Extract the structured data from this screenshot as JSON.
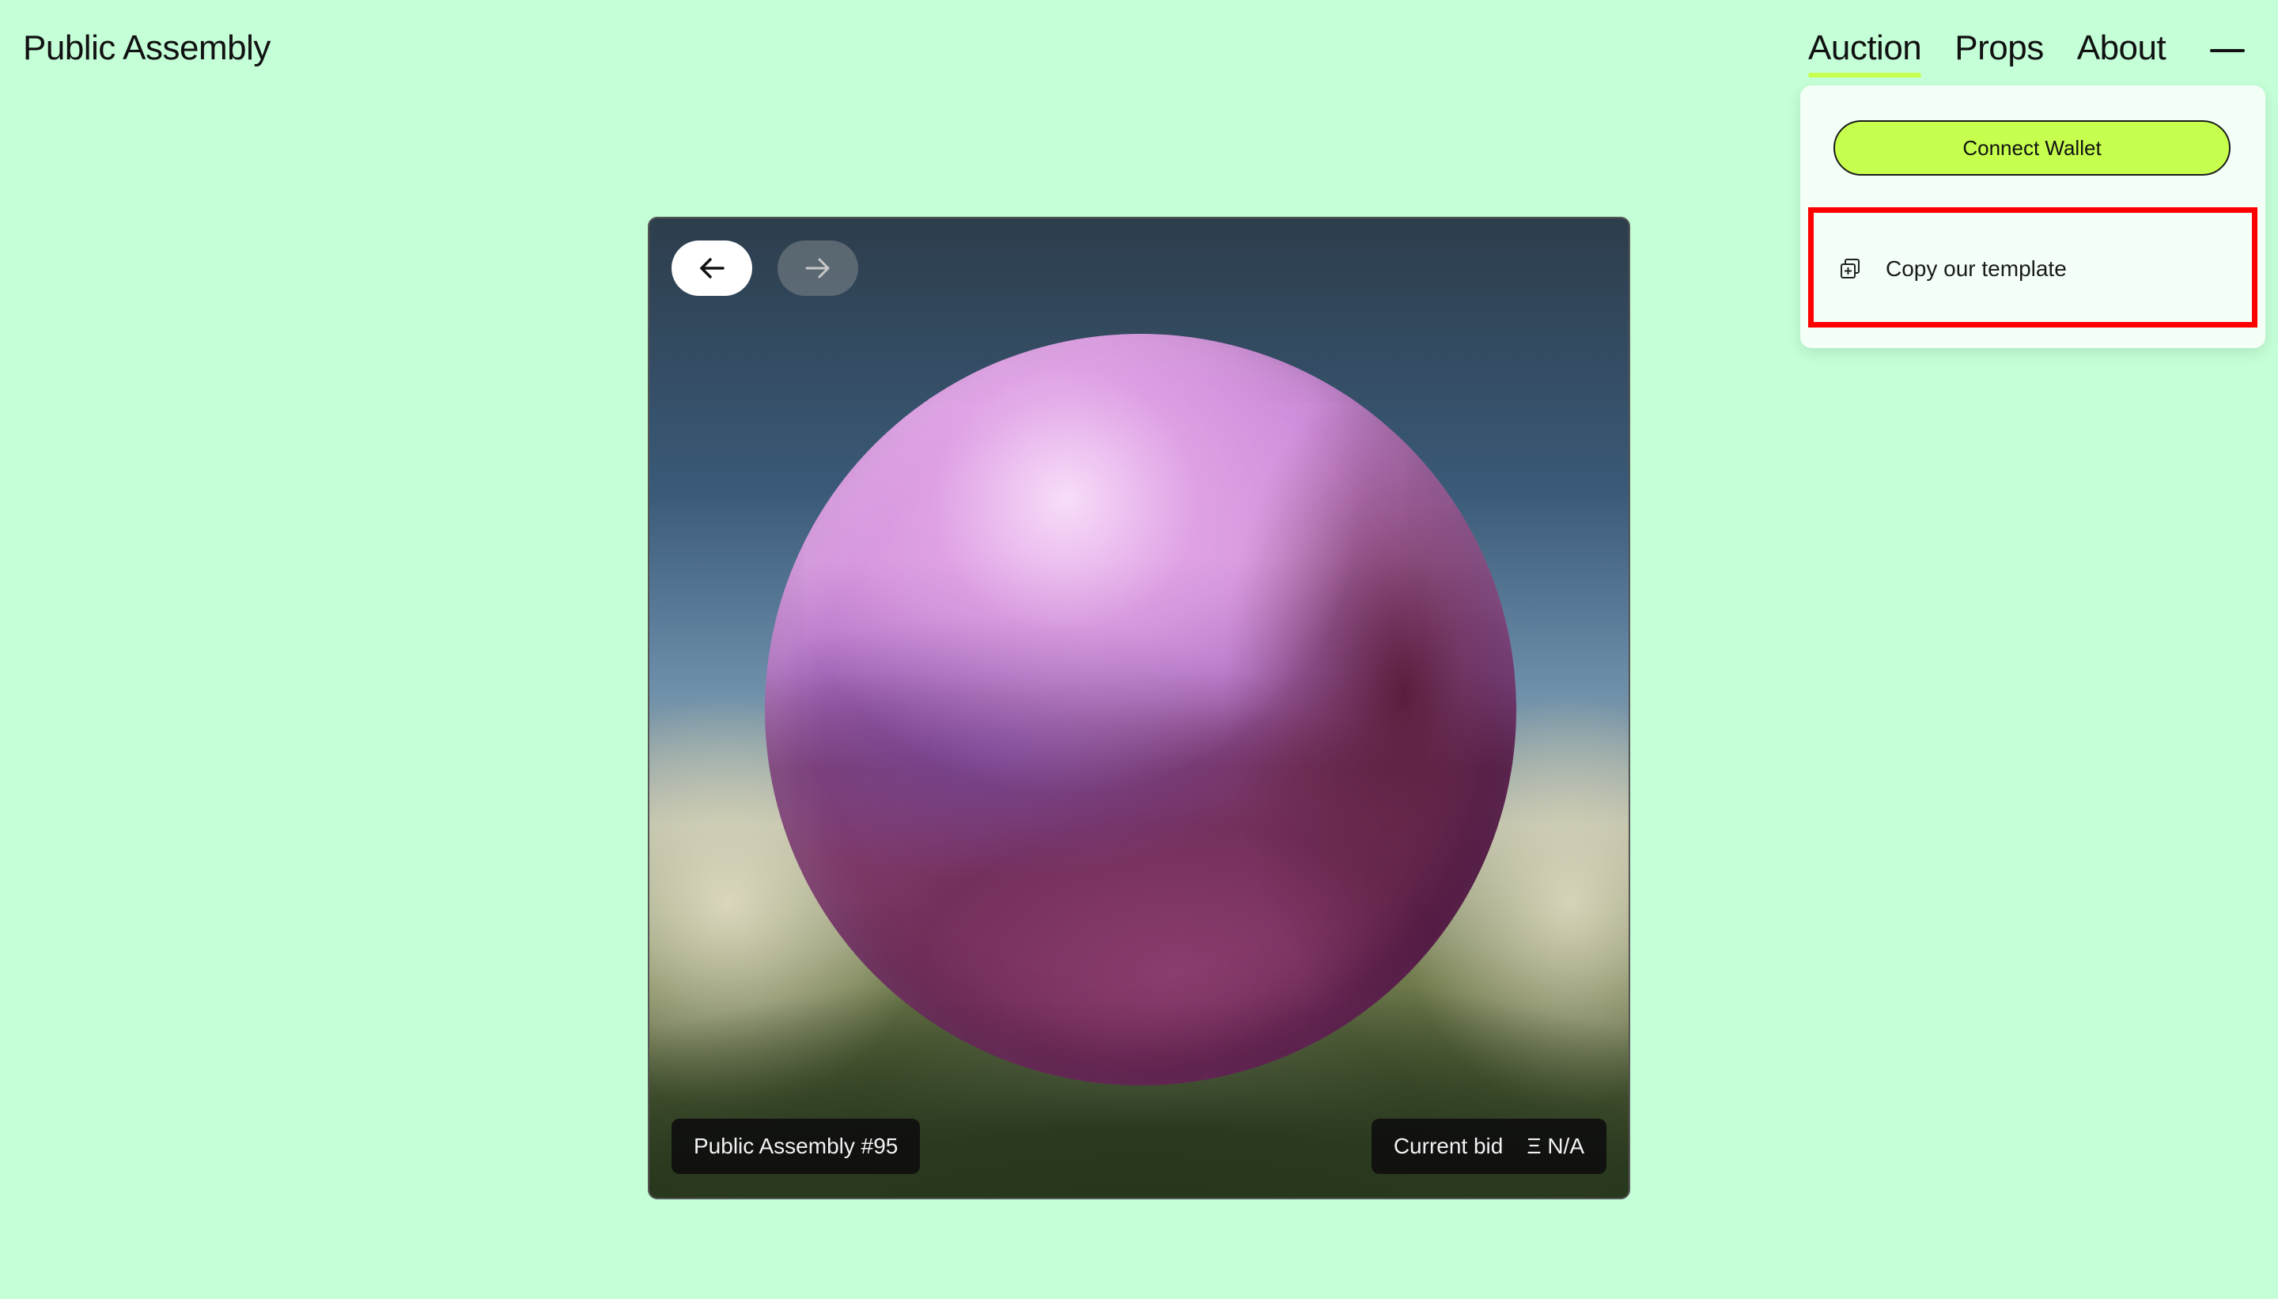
{
  "brand": {
    "name": "Public Assembly"
  },
  "nav": {
    "items": [
      {
        "label": "Auction",
        "active": true
      },
      {
        "label": "Props",
        "active": false
      },
      {
        "label": "About",
        "active": false
      }
    ],
    "menu_icon": "minus-icon"
  },
  "dropdown": {
    "connect_label": "Connect Wallet",
    "copy_label": "Copy our template",
    "copy_icon": "copy-plus-icon"
  },
  "artwork": {
    "title": "Public Assembly #95",
    "bid_label": "Current bid",
    "bid_value": "Ξ N/A",
    "prev_icon": "arrow-left-icon",
    "next_icon": "arrow-right-icon"
  },
  "colors": {
    "background": "#c4ffd7",
    "accent": "#c6ff4d",
    "highlight": "#ff0000"
  }
}
